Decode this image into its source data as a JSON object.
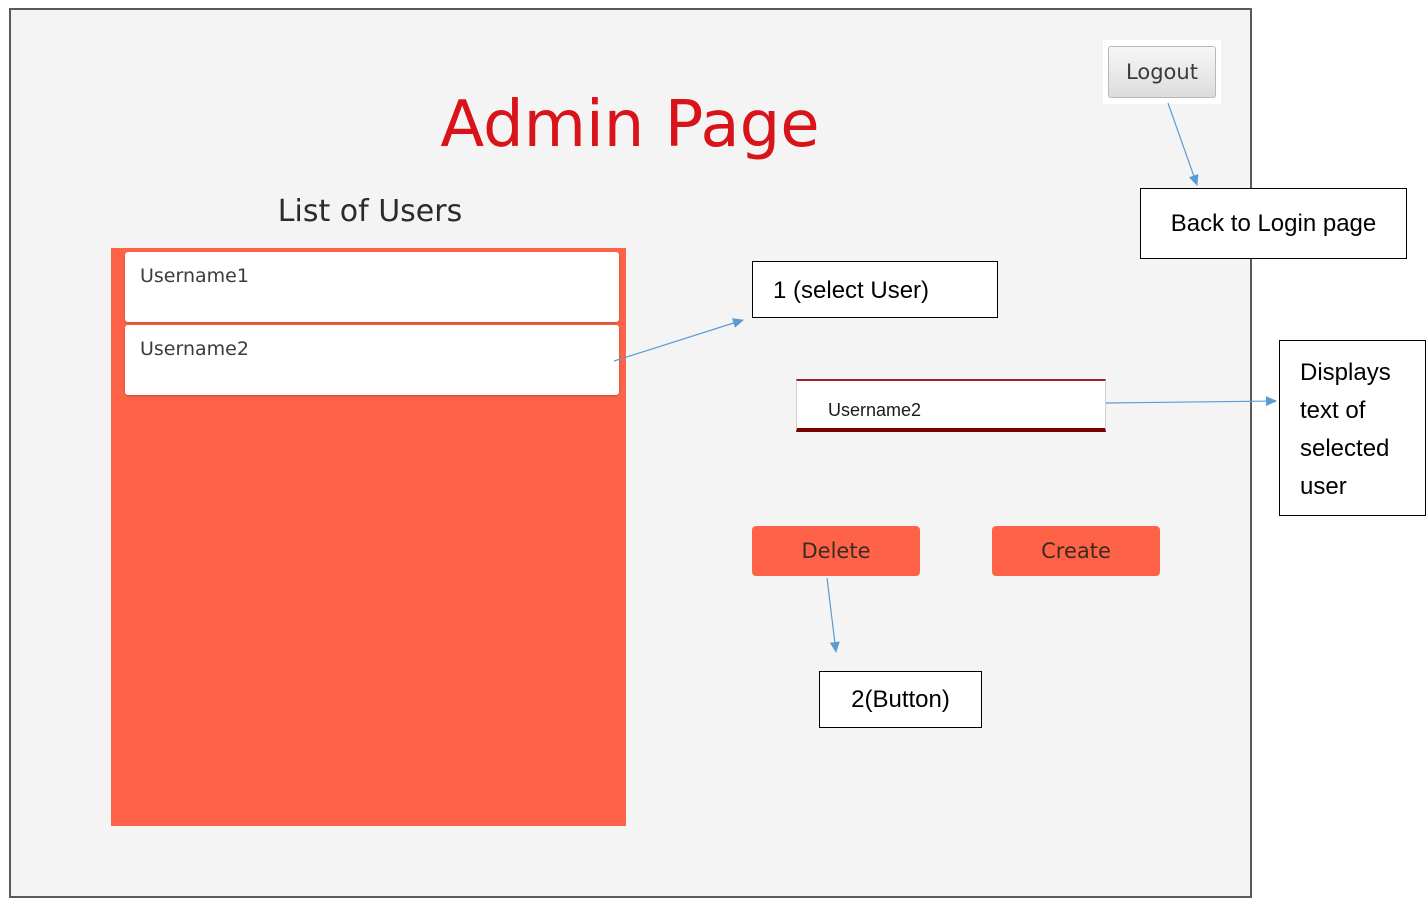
{
  "window": {
    "title": "Admin Page",
    "logout_label": "Logout"
  },
  "user_list": {
    "heading": "List of Users",
    "items": [
      {
        "label": "Username1"
      },
      {
        "label": "Username2"
      }
    ]
  },
  "selected_user": {
    "value": "Username2"
  },
  "actions": {
    "delete_label": "Delete",
    "create_label": "Create"
  },
  "annotations": {
    "back_to_login": "Back to Login page",
    "select_user": "1 (select User)",
    "displays_text": "Displays text of selected user",
    "button_note": "2(Button)"
  },
  "colors": {
    "title_red": "#d8141a",
    "list_background": "#ff6347",
    "button_background": "#ff6347",
    "arrow": "#5b9bd5"
  },
  "icons": {
    "arrow": "arrowhead"
  }
}
